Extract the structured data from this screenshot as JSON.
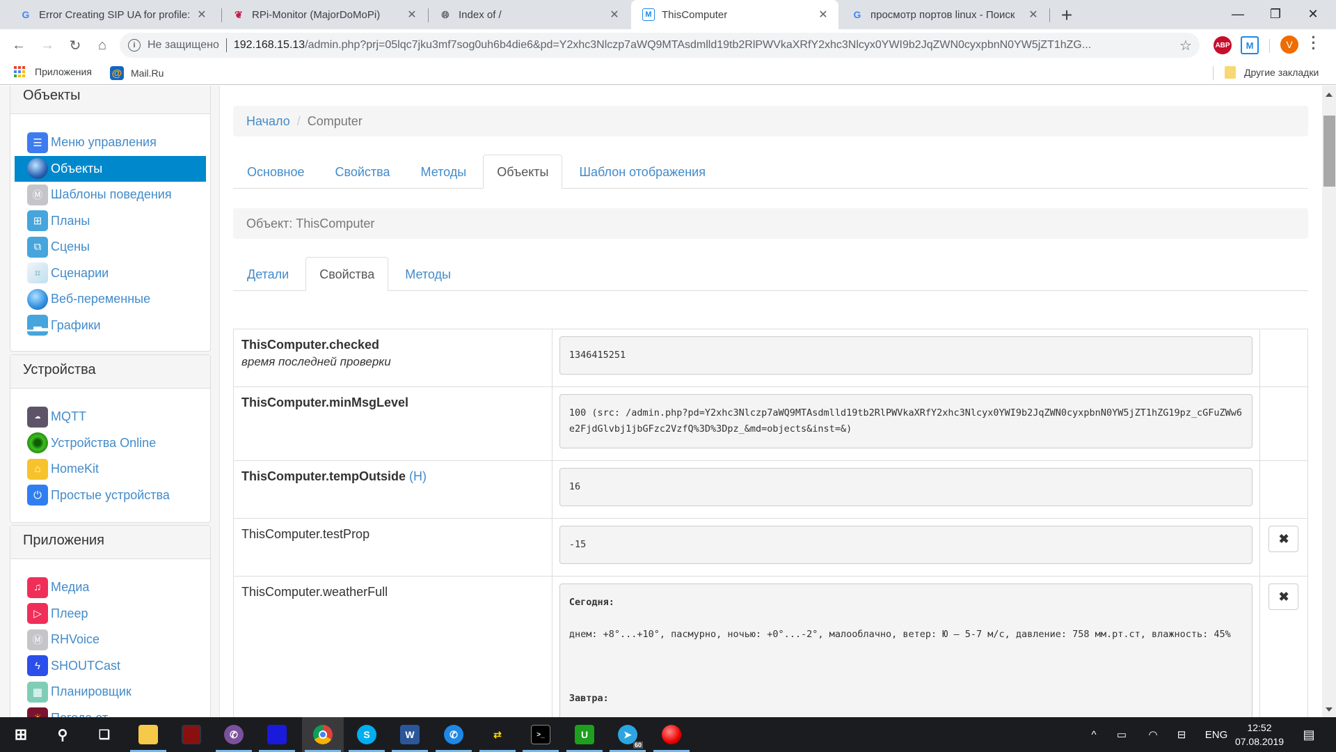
{
  "browser": {
    "tabs": [
      {
        "title": "Error Creating SIP UA for profile:",
        "icon": "google-icon",
        "active": false
      },
      {
        "title": "RPi-Monitor (MajorDoMoPi)",
        "icon": "raspberry-icon",
        "active": false
      },
      {
        "title": "Index of /",
        "icon": "globe-icon",
        "active": false
      },
      {
        "title": "ThisComputer",
        "icon": "majordomo-icon",
        "active": true
      },
      {
        "title": "просмотр портов linux - Поиск",
        "icon": "google-icon",
        "active": false
      }
    ],
    "new_tab": "+",
    "window_controls": {
      "minimize": "—",
      "maximize": "❐",
      "close": "✕"
    },
    "address": {
      "security_label": "Не защищено",
      "host": "192.168.15.13",
      "path": "/admin.php?prj=05lqc7jku3mf7sog0uh6b4die6&pd=Y2xhc3Nlczp7aWQ9MTAsdmlld19tb2RlPWVkaXRfY2xhc3Nlcyx0YWI9b2JqZWN0cyxpbnN0YW5jZT1hZG..."
    },
    "extensions": {
      "abp": "ABP",
      "majordomo": "M",
      "avatar_letter": "V"
    },
    "bookmarks": {
      "apps": "Приложения",
      "mailru": "Mail.Ru",
      "other": "Другие закладки"
    }
  },
  "sidebar": {
    "panels": [
      {
        "title": "Объекты",
        "items": [
          {
            "label": "Меню управления",
            "icon": "menu-icon",
            "color": "#3d7bef",
            "active": false
          },
          {
            "label": "Объекты",
            "icon": "sphere-icon",
            "color": "#2a62b5",
            "active": true
          },
          {
            "label": "Шаблоны поведения",
            "icon": "majordomo-icon",
            "color": "#c4c4c9",
            "active": false
          },
          {
            "label": "Планы",
            "icon": "floorplan-icon",
            "color": "#45a5dc",
            "active": false
          },
          {
            "label": "Сцены",
            "icon": "scenes-icon",
            "color": "#45a5dc",
            "active": false
          },
          {
            "label": "Сценарии",
            "icon": "flowchart-icon",
            "color": "#bfe0f0",
            "active": false
          },
          {
            "label": "Веб-переменные",
            "icon": "globe-gear-icon",
            "color": "#2f8ede",
            "active": false
          },
          {
            "label": "Графики",
            "icon": "chart-icon",
            "color": "#45a5dc",
            "active": false
          }
        ]
      },
      {
        "title": "Устройства",
        "items": [
          {
            "label": "MQTT",
            "icon": "mqtt-icon",
            "color": "#5e5468",
            "active": false
          },
          {
            "label": "Устройства Online",
            "icon": "online-dot-icon",
            "color": "#2e9a16",
            "active": false
          },
          {
            "label": "HomeKit",
            "icon": "homekit-icon",
            "color": "#f7c22b",
            "active": false
          },
          {
            "label": "Простые устройства",
            "icon": "power-icon",
            "color": "#2f7ff0",
            "active": false
          }
        ]
      },
      {
        "title": "Приложения",
        "items": [
          {
            "label": "Медиа",
            "icon": "music-icon",
            "color": "#ef2f58",
            "active": false
          },
          {
            "label": "Плеер",
            "icon": "play-icon",
            "color": "#ef2f58",
            "active": false
          },
          {
            "label": "RHVoice",
            "icon": "majordomo-icon",
            "color": "#c4c4c9",
            "active": false
          },
          {
            "label": "SHOUTCast",
            "icon": "shoutcast-icon",
            "color": "#2a4fea",
            "active": false
          },
          {
            "label": "Планировщик",
            "icon": "calendar-icon",
            "color": "#7fcdb6",
            "active": false
          },
          {
            "label": "Погода от",
            "icon": "weather-icon",
            "color": "#7a1330",
            "active": false
          }
        ]
      }
    ]
  },
  "breadcrumb": {
    "home": "Начало",
    "separator": "/",
    "current": "Computer"
  },
  "main_tabs": [
    {
      "label": "Основное",
      "active": false
    },
    {
      "label": "Свойства",
      "active": false
    },
    {
      "label": "Методы",
      "active": false
    },
    {
      "label": "Объекты",
      "active": true
    },
    {
      "label": "Шаблон отображения",
      "active": false
    }
  ],
  "object_bar": "Объект: ThisComputer",
  "sub_tabs": [
    {
      "label": "Детали",
      "active": false
    },
    {
      "label": "Свойства",
      "active": true
    },
    {
      "label": "Методы",
      "active": false
    }
  ],
  "properties": [
    {
      "name": "ThisComputer.checked",
      "bold": true,
      "description": "время последней проверки",
      "value": "1346415251",
      "deletable": false
    },
    {
      "name": "ThisComputer.minMsgLevel",
      "bold": true,
      "description": "",
      "value": "100 (src: /admin.php?pd=Y2xhc3Nlczp7aWQ9MTAsdmlld19tb2RlPWVkaXRfY2xhc3Nlcyx0YWI9b2JqZWN0cyxpbnN0YW5jZT1hZG19pz_cGFuZWw6e2FjdGlvbj1jbGFzc2VzfQ%3D%3Dpz_&md=objects&inst=&)",
      "deletable": false
    },
    {
      "name": "ThisComputer.tempOutside",
      "bold": true,
      "history_link": "H",
      "description": "",
      "value": "16",
      "deletable": false
    },
    {
      "name": "ThisComputer.testProp",
      "bold": false,
      "description": "",
      "value": "-15",
      "deletable": true
    },
    {
      "name": "ThisComputer.weatherFull",
      "bold": false,
      "description": "",
      "deletable": true,
      "weather": {
        "today_label": "Сегодня:",
        "today_text": "днем: +8°...+10°, пасмурно, ночью: +0°...-2°, малооблачно, ветер: Ю – 5-7 м/с, давление: 758 мм.рт.ст, влажность: 45%",
        "tomorrow_label": "Завтра:"
      }
    }
  ],
  "delete_glyph": "✖",
  "taskbar": {
    "apps": [
      {
        "name": "start-button",
        "glyph": "⊞"
      },
      {
        "name": "search-button",
        "glyph": "⚲"
      },
      {
        "name": "task-view-button",
        "glyph": "❏"
      },
      {
        "name": "file-explorer",
        "glyph": "📁"
      },
      {
        "name": "app-red-device",
        "glyph": "▤"
      },
      {
        "name": "viber",
        "glyph": "✆"
      },
      {
        "name": "app-floppy",
        "glyph": "💾"
      },
      {
        "name": "chrome",
        "glyph": "◉"
      },
      {
        "name": "skype",
        "glyph": "S"
      },
      {
        "name": "word",
        "glyph": "W"
      },
      {
        "name": "phone-app",
        "glyph": "✆"
      },
      {
        "name": "network-app",
        "glyph": "⇄"
      },
      {
        "name": "terminal",
        "glyph": ">_"
      },
      {
        "name": "utorrent",
        "glyph": "U"
      },
      {
        "name": "telegram",
        "glyph": "➤"
      },
      {
        "name": "red-ball-app",
        "glyph": "●"
      }
    ],
    "telegram_badge": "60",
    "tray": {
      "chevron": "^",
      "language": "ENG",
      "time": "12:52",
      "date": "07.08.2019"
    }
  }
}
